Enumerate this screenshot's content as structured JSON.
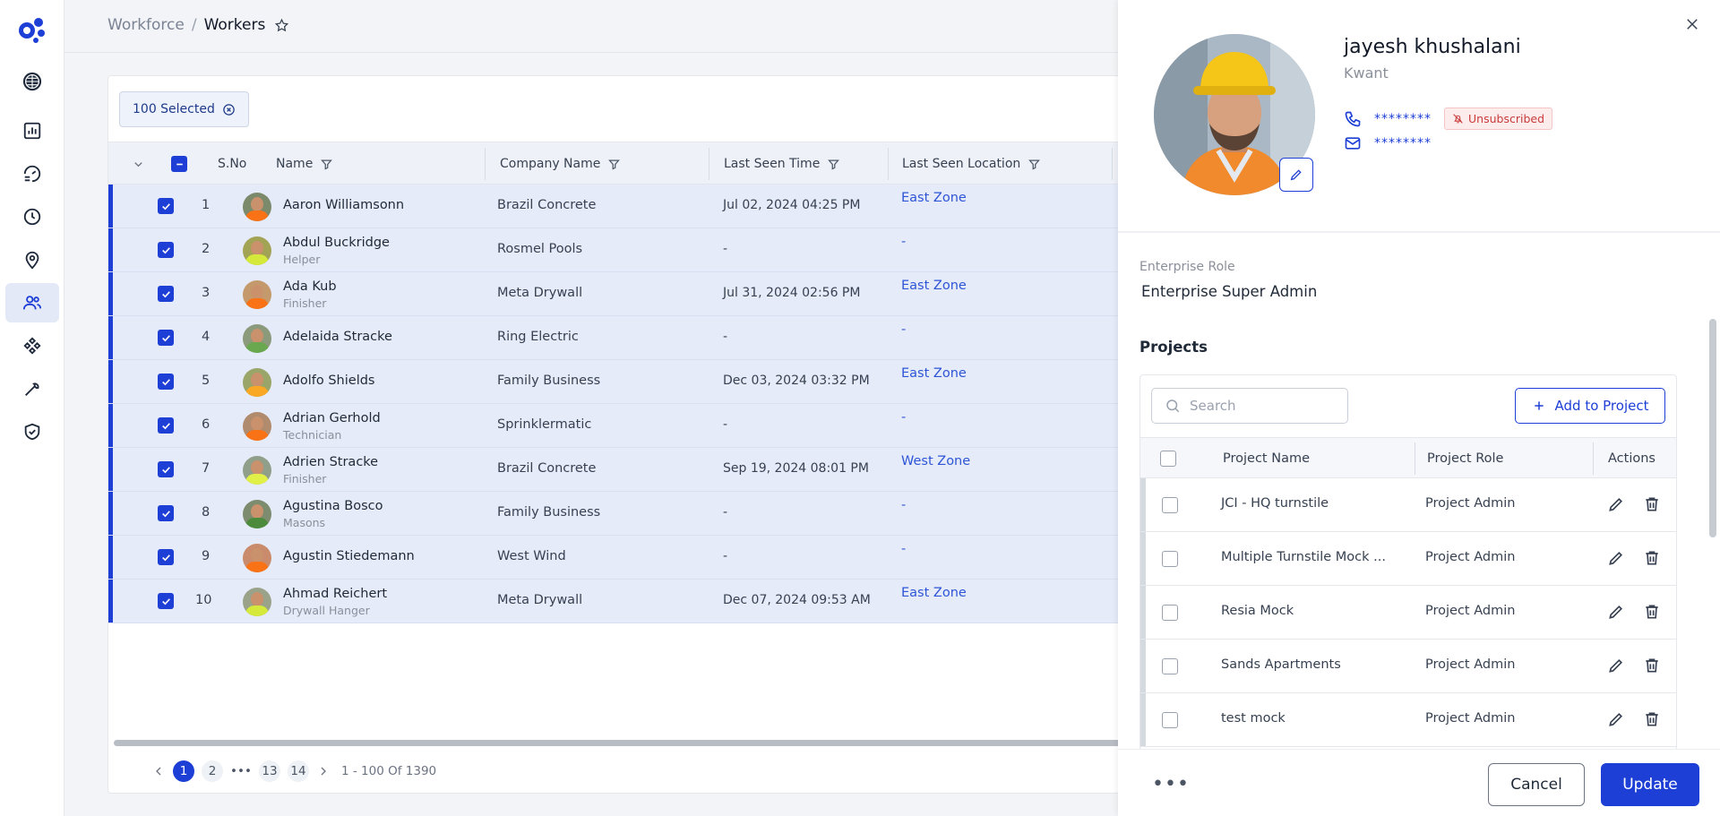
{
  "breadcrumb": {
    "parent": "Workforce",
    "separator": "/",
    "current": "Workers"
  },
  "selection": {
    "chip_label": "100 Selected"
  },
  "table": {
    "columns": {
      "sno": "S.No",
      "name": "Name",
      "company": "Company Name",
      "last_seen_time": "Last Seen Time",
      "last_seen_location": "Last Seen Location"
    },
    "rows": [
      {
        "sno": "1",
        "name": "Aaron Williamsonn",
        "role": "",
        "company": "Brazil Concrete",
        "time": "Jul 02, 2024 04:25 PM",
        "location": "East Zone"
      },
      {
        "sno": "2",
        "name": "Abdul Buckridge",
        "role": "Helper",
        "company": "Rosmel Pools",
        "time": "-",
        "location": "-"
      },
      {
        "sno": "3",
        "name": "Ada Kub",
        "role": "Finisher",
        "company": "Meta Drywall",
        "time": "Jul 31, 2024 02:56 PM",
        "location": "East Zone"
      },
      {
        "sno": "4",
        "name": "Adelaida Stracke",
        "role": "",
        "company": "Ring Electric",
        "time": "-",
        "location": "-"
      },
      {
        "sno": "5",
        "name": "Adolfo Shields",
        "role": "",
        "company": "Family Business",
        "time": "Dec 03, 2024 03:32 PM",
        "location": "East Zone"
      },
      {
        "sno": "6",
        "name": "Adrian Gerhold",
        "role": "Technician",
        "company": "Sprinklermatic",
        "time": "-",
        "location": "-"
      },
      {
        "sno": "7",
        "name": "Adrien Stracke",
        "role": "Finisher",
        "company": "Brazil Concrete",
        "time": "Sep 19, 2024 08:01 PM",
        "location": "West Zone"
      },
      {
        "sno": "8",
        "name": "Agustina Bosco",
        "role": "Masons",
        "company": "Family Business",
        "time": "-",
        "location": "-"
      },
      {
        "sno": "9",
        "name": "Agustin Stiedemann",
        "role": "",
        "company": "West Wind",
        "time": "-",
        "location": "-"
      },
      {
        "sno": "10",
        "name": "Ahmad Reichert",
        "role": "Drywall Hanger",
        "company": "Meta Drywall",
        "time": "Dec 07, 2024 09:53 AM",
        "location": "East Zone"
      }
    ]
  },
  "pagination": {
    "pages": [
      "1",
      "2",
      "•••",
      "13",
      "14"
    ],
    "range": "1 - 100 Of 1390"
  },
  "panel": {
    "name": "jayesh khushalani",
    "company": "Kwant",
    "phone": "********",
    "email": "********",
    "unsubscribed": "Unsubscribed",
    "enterprise_role_label": "Enterprise Role",
    "enterprise_role_value": "Enterprise Super Admin",
    "projects_heading": "Projects",
    "search_placeholder": "Search",
    "add_to_project": "Add to Project",
    "project_columns": {
      "name": "Project Name",
      "role": "Project Role",
      "actions": "Actions"
    },
    "projects": [
      {
        "name": "JCI - HQ turnstile",
        "role": "Project Admin"
      },
      {
        "name": "Multiple Turnstile Mock ...",
        "role": "Project Admin"
      },
      {
        "name": "Resia Mock",
        "role": "Project Admin"
      },
      {
        "name": "Sands Apartments",
        "role": "Project Admin"
      },
      {
        "name": "test mock",
        "role": "Project Admin"
      }
    ],
    "more": "•••",
    "cancel": "Cancel",
    "update": "Update"
  },
  "colors": {
    "accent": "#1d3fd6",
    "row_selected": "#e6ebf9",
    "zone_link": "#2d55d6",
    "unsubscribed": "#c93b3b"
  }
}
